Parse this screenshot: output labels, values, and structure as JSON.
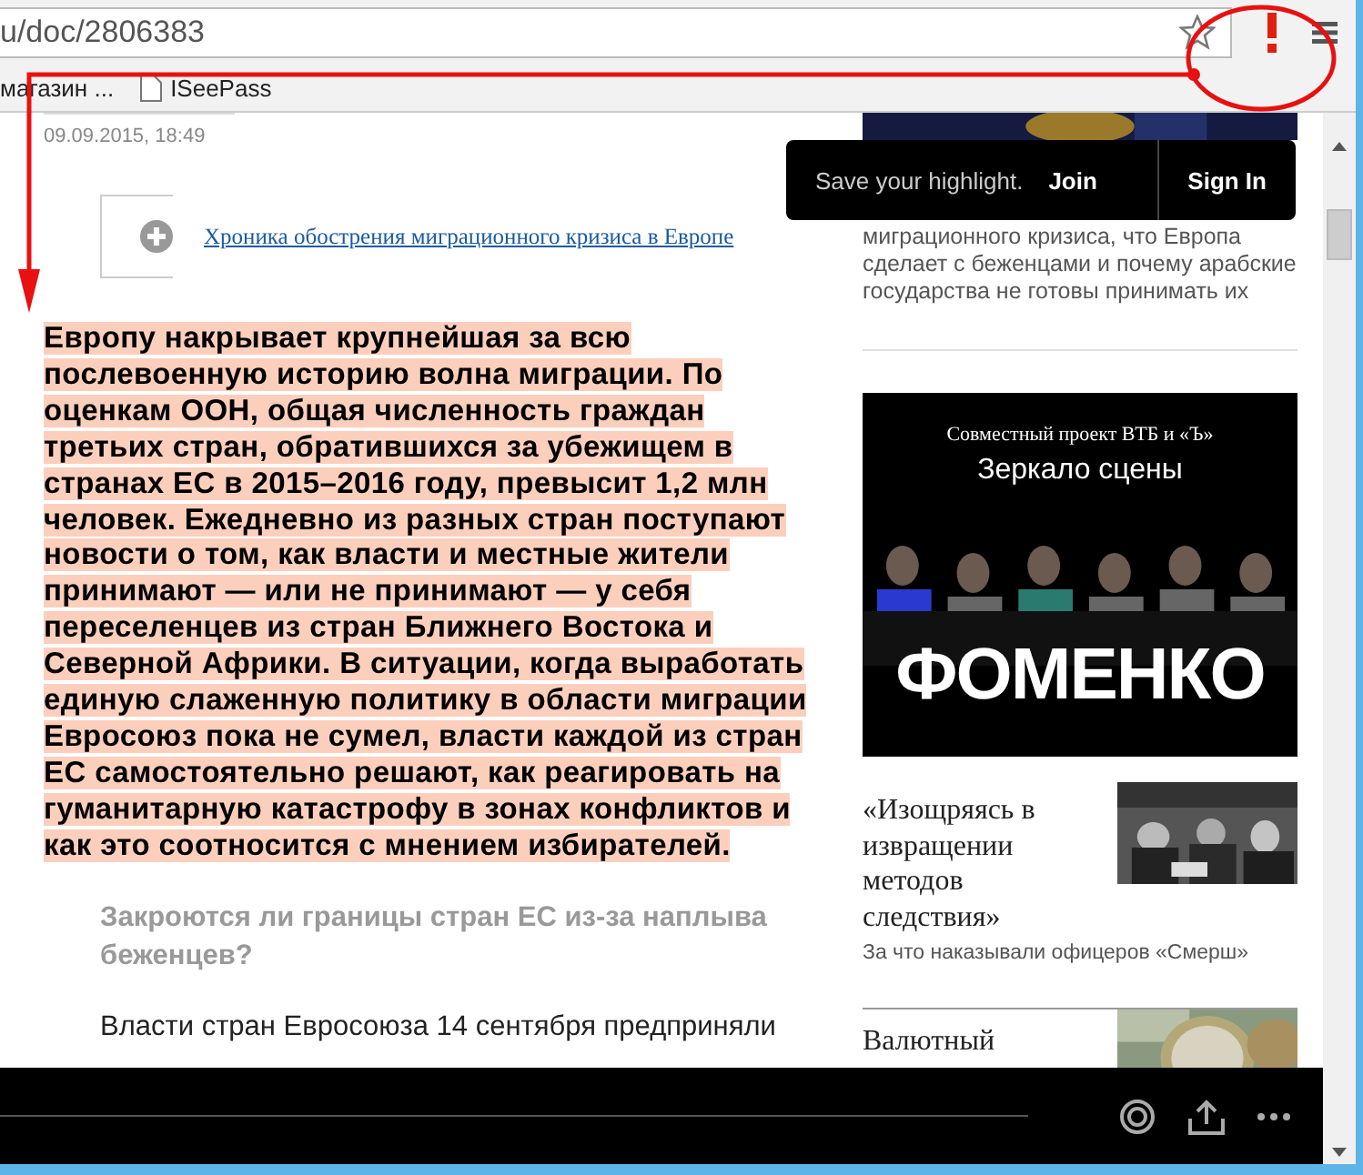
{
  "browser": {
    "url": "u/doc/2806383",
    "bookmarks": [
      {
        "label": "магазин ...",
        "kind": "text"
      },
      {
        "label": "ISeePass",
        "kind": "page"
      }
    ]
  },
  "article": {
    "date": "09.09.2015, 18:49",
    "related_link": "Хроника обострения миграционного кризиса в Европе",
    "highlighted_paragraph": "Европу накрывает крупнейшая за всю послевоенную историю волна миграции. По оценкам ООН, общая численность граждан третьих стран, обратившихся за убежищем в странах ЕС в 2015–2016 году, превысит 1,2 млн человек. Ежедневно из разных стран поступают новости о том, как власти и местные жители принимают — или не принимают — у себя переселенцев из стран Ближнего Востока и Северной Африки. В ситуации, когда выработать единую слаженную политику в области миграции Евросоюз пока не сумел, власти каждой из стран ЕС самостоятельно решают, как реагировать на гуманитарную катастрофу в зонах конфликтов и как это соотносится с мнением избирателей.",
    "subheading": "Закроются ли границы стран ЕС из-за наплыва беженцев?",
    "body": "Власти стран Евросоюза 14 сентября предприняли"
  },
  "highlight_popup": {
    "message": "Save your highlight.",
    "join": "Join",
    "sign_in": "Sign In"
  },
  "sidebar": {
    "teaser": "миграционного кризиса, что Европа сделает с беженцами и почему арабские государства не готовы принимать их",
    "ad": {
      "kind": "picture",
      "tagline": "Совместный проект ВТБ и «Ъ»",
      "title": "Зеркало сцены",
      "headline": "ФОМЕНКО"
    },
    "stories": [
      {
        "title": "«Изощряясь в извращении методов следствия»",
        "subtitle": "За что наказывали офицеров «Смерш»",
        "kind": "archive"
      },
      {
        "title": "Валютный",
        "kind": "coins"
      }
    ]
  }
}
